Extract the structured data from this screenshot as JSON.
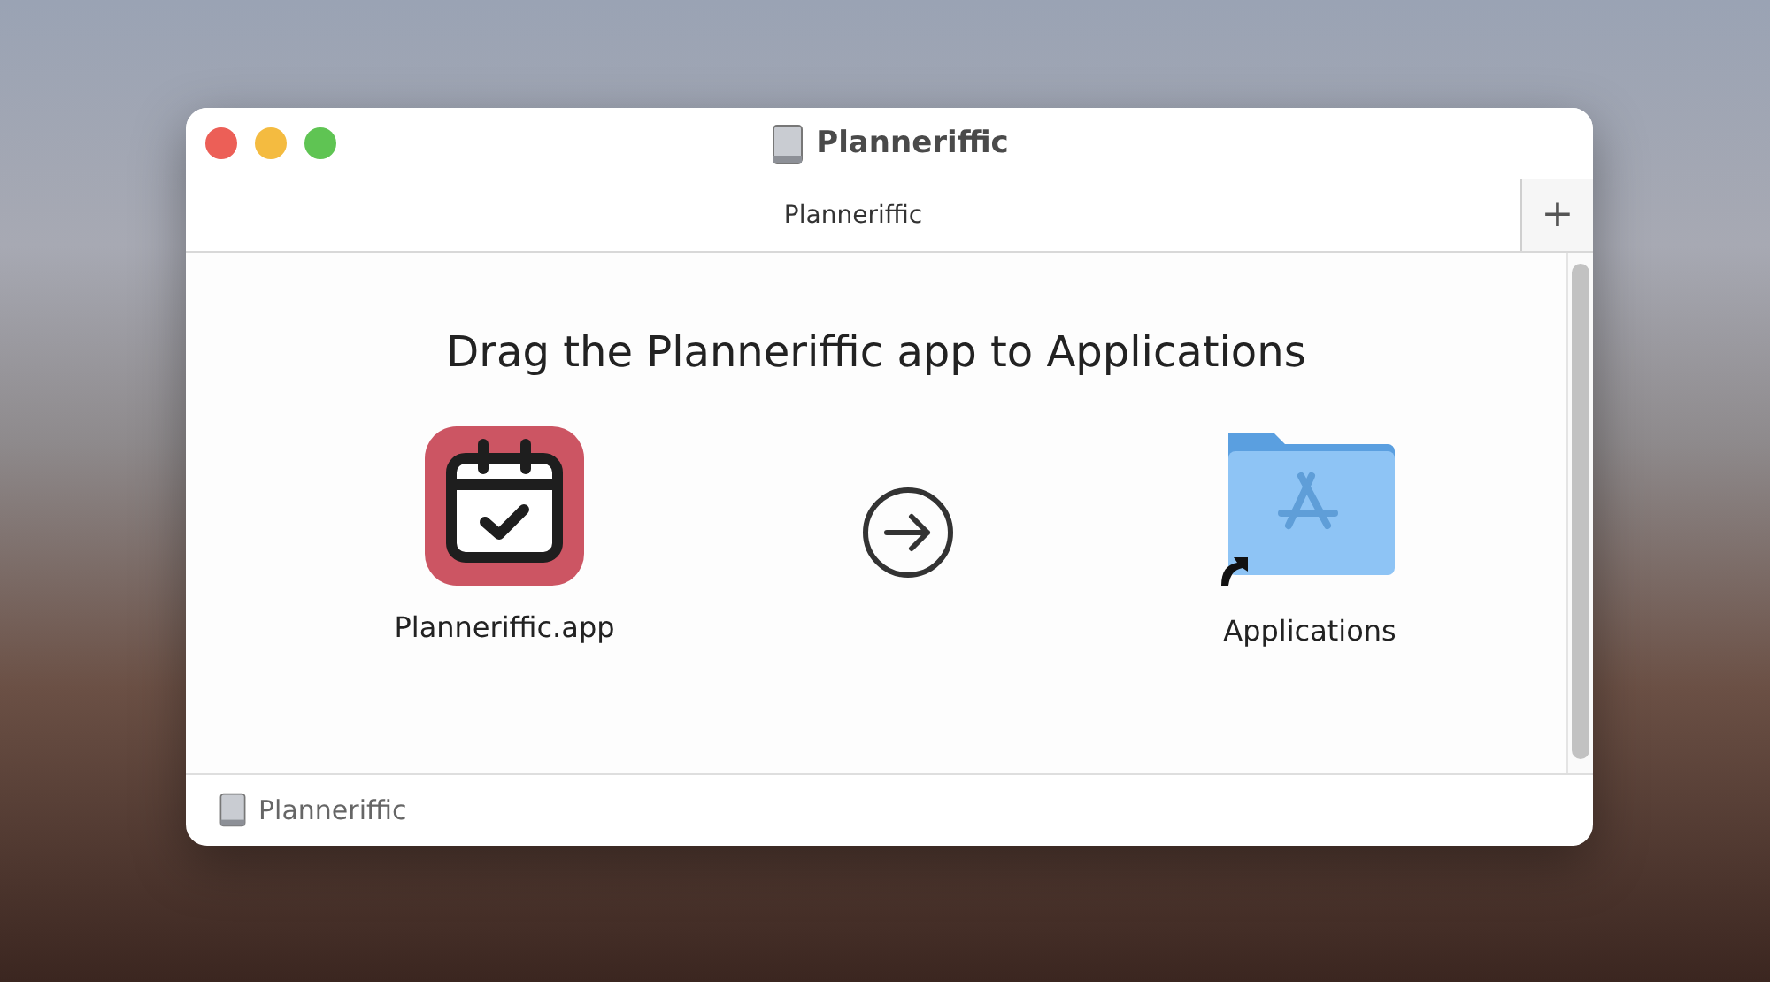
{
  "window": {
    "title": "Planneriffic"
  },
  "tabs": [
    {
      "label": "Planneriffic",
      "selected": true
    }
  ],
  "add_tab_button": {
    "label": "+"
  },
  "content": {
    "heading": "Drag the Planneriffic app to Applications",
    "items": [
      {
        "kind": "app",
        "label": "Planneriffic.app"
      },
      {
        "kind": "arrow"
      },
      {
        "kind": "folder",
        "label": "Applications"
      }
    ]
  },
  "status_bar": {
    "label": "Planneriffic"
  }
}
